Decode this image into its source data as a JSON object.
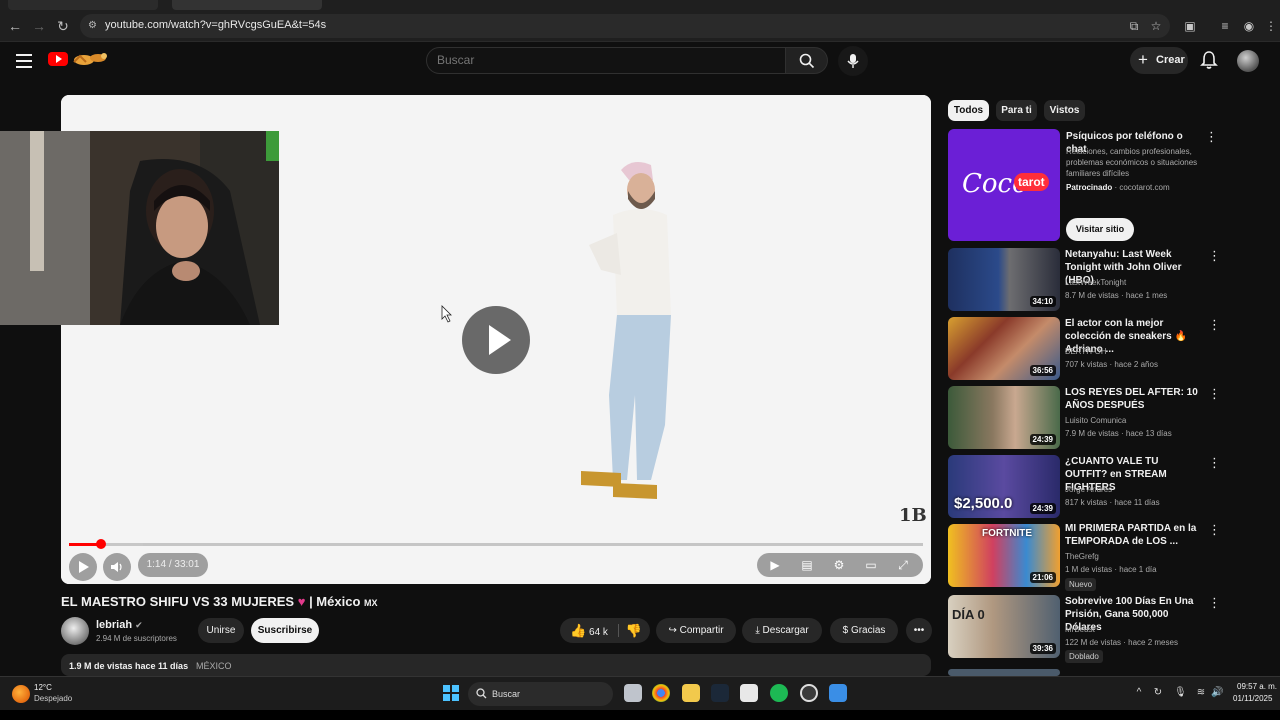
{
  "browser": {
    "url": "youtube.com/watch?v=ghRVcgsGuEA&t=54s"
  },
  "header": {
    "search_placeholder": "Buscar",
    "create_label": "Crear"
  },
  "player": {
    "time_display": "1:14 / 33:01",
    "progress_fraction": 0.037,
    "watermark": "1B"
  },
  "video": {
    "title": "EL MAESTRO SHIFU VS 33 MUJERES",
    "title_suffix": "| México",
    "country_code": "MX",
    "channel_name": "lebriah",
    "subscribers": "2.94 M de suscriptores",
    "join_label": "Unirse",
    "subscribe_label": "Suscribirse",
    "likes": "64 k",
    "share_label": "Compartir",
    "download_label": "Descargar",
    "thanks_label": "Gracias",
    "views_date": "1.9 M de vistas  hace 11 días",
    "country": "MÉXICO"
  },
  "chips": [
    "Todos",
    "Para ti",
    "Vistos"
  ],
  "ad": {
    "title": "Psíquicos por teléfono o chat",
    "description": "Relaciones, cambios profesionales, problemas económicos o situaciones familiares difíciles",
    "sponsored": "Patrocinado",
    "domain": "cocotarot.com",
    "visit_label": "Visitar sitio",
    "logo_text_1": "Coco",
    "logo_text_2": "tarot"
  },
  "recommendations": [
    {
      "title": "Netanyahu: Last Week Tonight with John Oliver (HBO)",
      "channel": "LastWeekTonight",
      "meta": "8.7 M de vistas · hace 1 mes",
      "duration": "34:10"
    },
    {
      "title": "El actor con la mejor colección de sneakers 🔥 Adriano ...",
      "channel": "BERTH-OH",
      "meta": "707 k vistas · hace 2 años",
      "duration": "36:56"
    },
    {
      "title": "LOS REYES DEL AFTER: 10 AÑOS DESPUÉS",
      "channel": "Luisito Comunica",
      "meta": "7.9 M de vistas · hace 13 días",
      "duration": "24:39"
    },
    {
      "title": "¿CUANTO VALE TU OUTFIT? en STREAM FIGHTERS",
      "channel": "Jorge Andrés",
      "meta": "817 k vistas · hace 11 días",
      "duration": "24:39",
      "thumb_text": "$2,500.0"
    },
    {
      "title": "MI PRIMERA PARTIDA en la TEMPORADA de LOS ...",
      "channel": "TheGrefg",
      "meta": "1 M de vistas · hace 1 día",
      "duration": "21:06",
      "badge": "Nuevo",
      "thumb_text": "FORTNITE"
    },
    {
      "title": "Sobrevive 100 Días En Una Prisión, Gana 500,000 Dólares",
      "channel": "MrBeast",
      "meta": "122 M de vistas · hace 2 meses",
      "duration": "39:36",
      "badge": "Doblado",
      "thumb_text": "DÍA 0"
    }
  ],
  "taskbar": {
    "temperature": "12°C",
    "weather": "Despejado",
    "search_label": "Buscar",
    "time": "09:57 a. m.",
    "date": "01/11/2025"
  }
}
